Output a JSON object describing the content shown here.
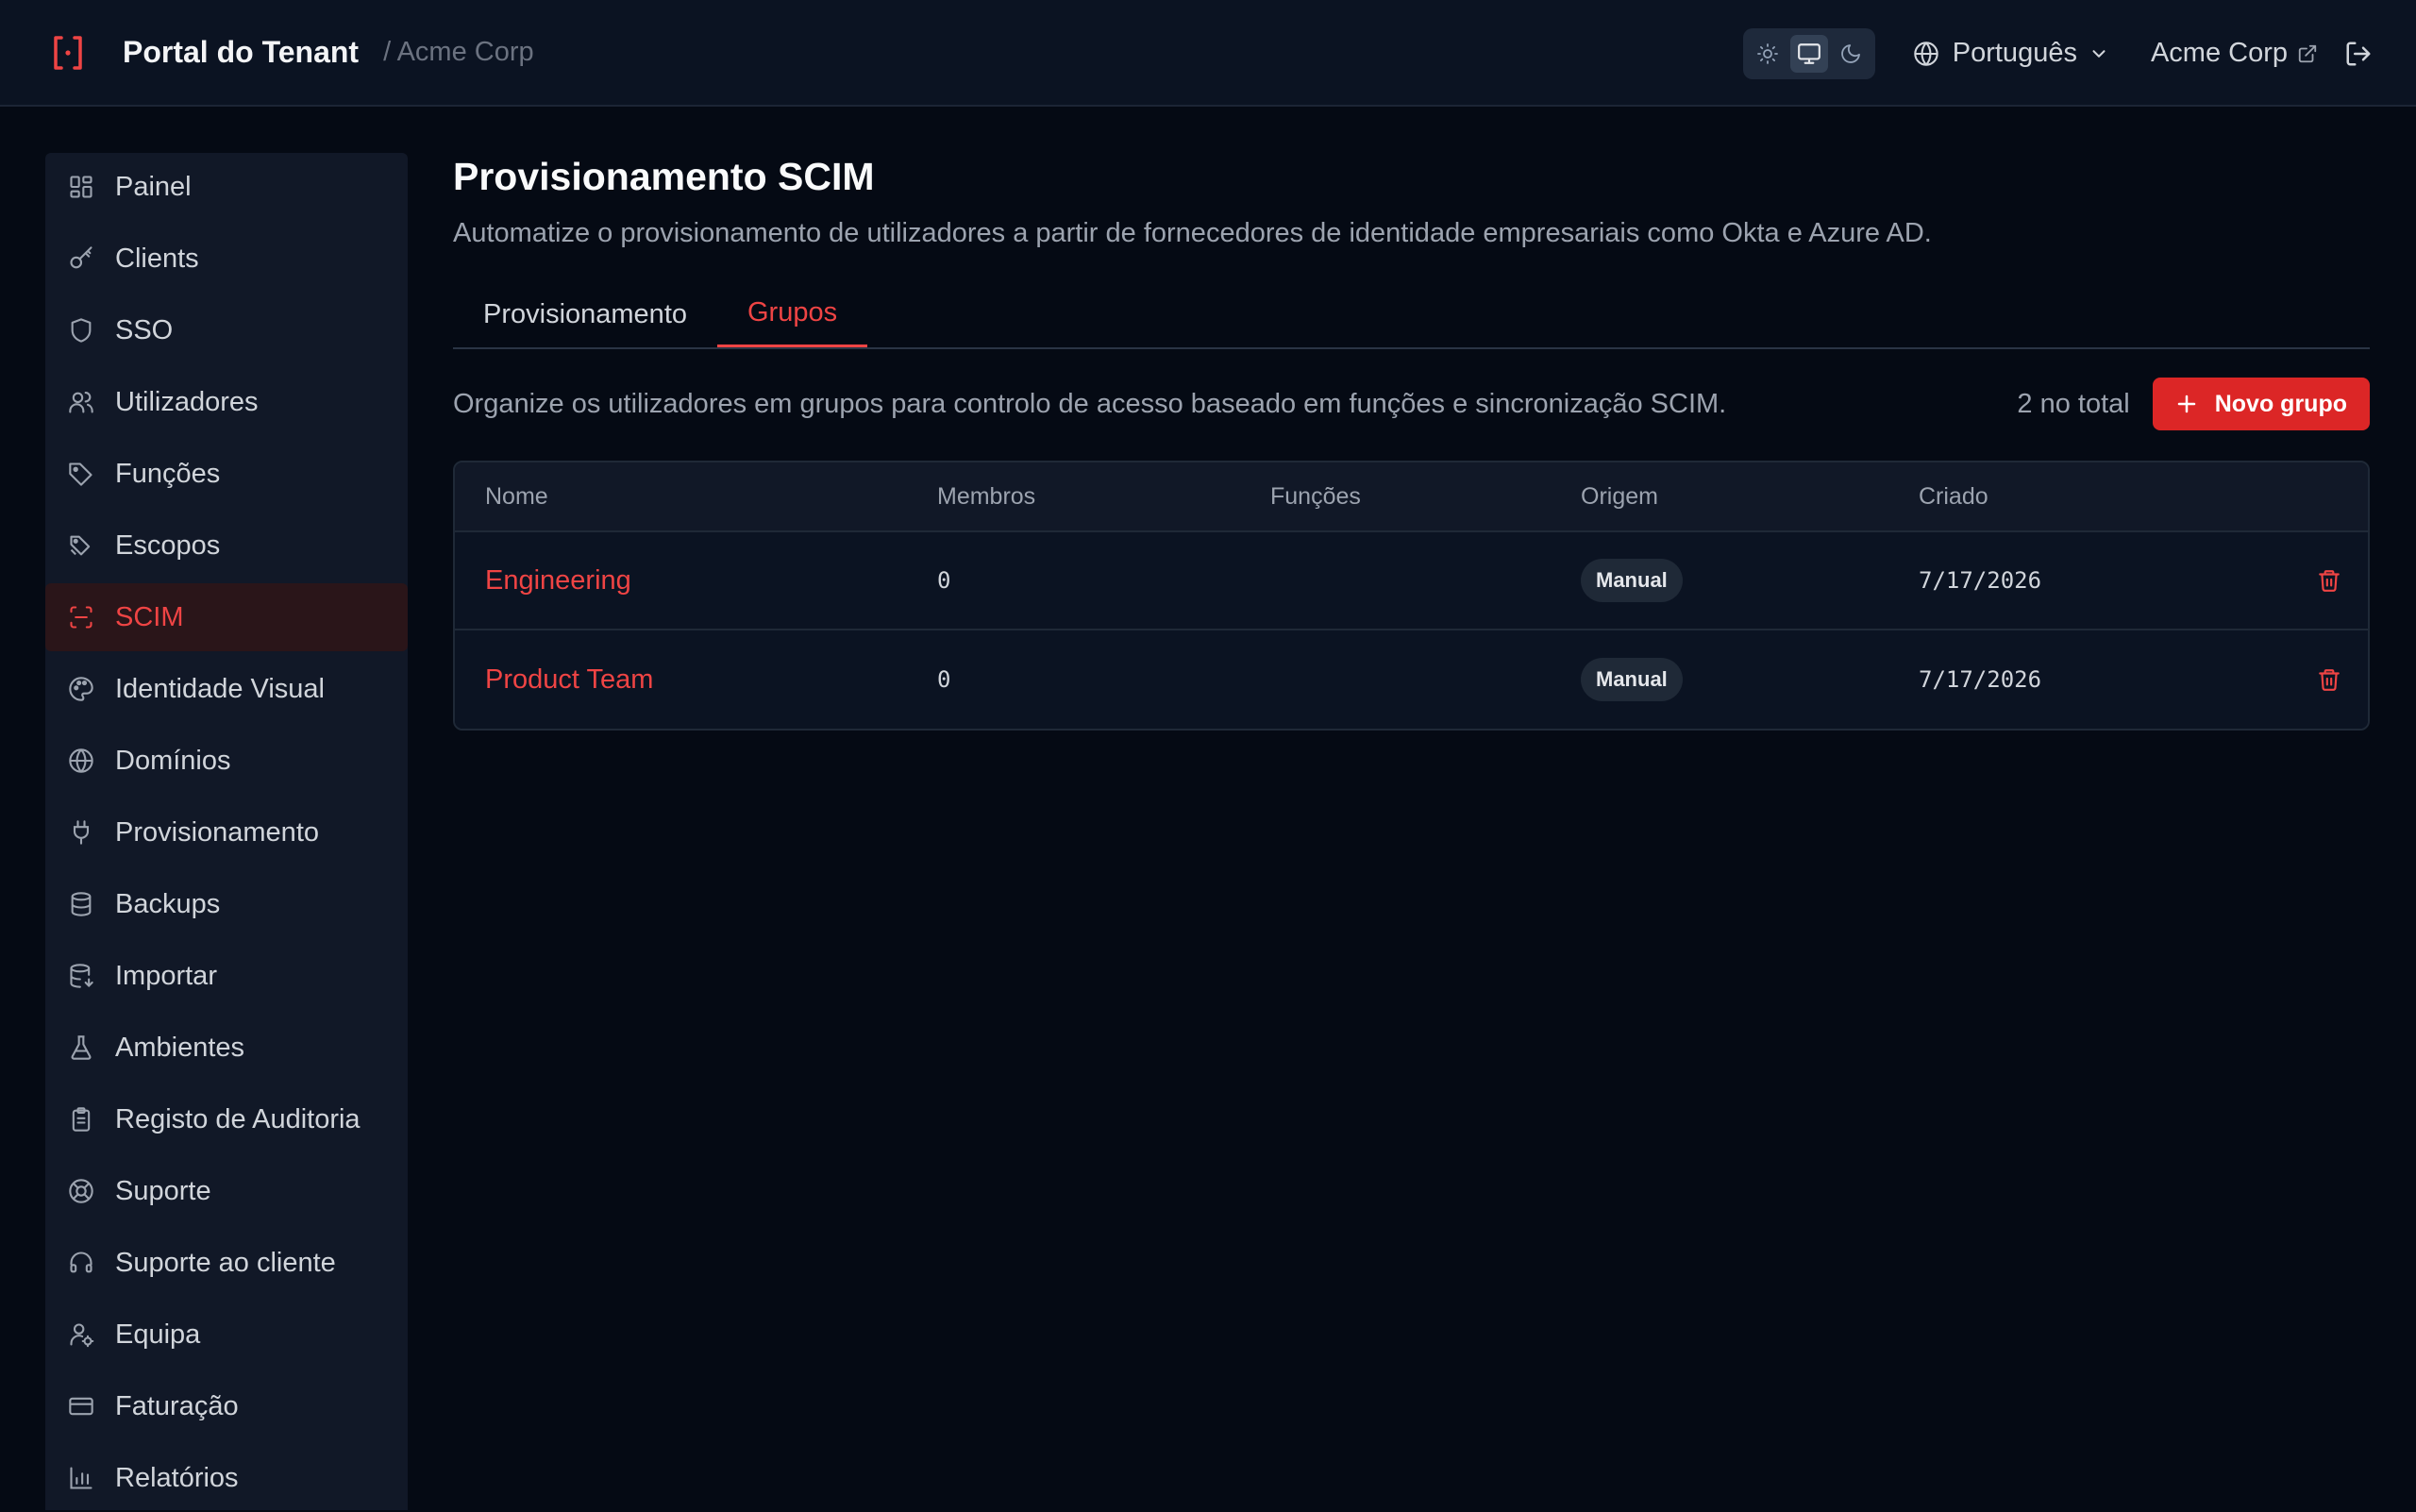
{
  "header": {
    "title": "Portal do Tenant",
    "breadcrumb": "/ Acme Corp",
    "theme_options": [
      "sun-icon",
      "monitor-icon",
      "moon-icon"
    ],
    "theme_selected": "monitor-icon",
    "language": "Português",
    "tenant_name": "Acme Corp"
  },
  "sidebar": {
    "items": [
      {
        "label": "Painel",
        "icon": "dashboard-icon"
      },
      {
        "label": "Clients",
        "icon": "key-icon"
      },
      {
        "label": "SSO",
        "icon": "shield-icon"
      },
      {
        "label": "Utilizadores",
        "icon": "users-icon"
      },
      {
        "label": "Funções",
        "icon": "tag-icon"
      },
      {
        "label": "Escopos",
        "icon": "tags-icon"
      },
      {
        "label": "SCIM",
        "icon": "scan-icon",
        "active": true
      },
      {
        "label": "Identidade Visual",
        "icon": "palette-icon"
      },
      {
        "label": "Domínios",
        "icon": "globe-icon"
      },
      {
        "label": "Provisionamento",
        "icon": "plug-icon"
      },
      {
        "label": "Backups",
        "icon": "database-icon"
      },
      {
        "label": "Importar",
        "icon": "database-import-icon"
      },
      {
        "label": "Ambientes",
        "icon": "flask-icon"
      },
      {
        "label": "Registo de Auditoria",
        "icon": "clipboard-icon"
      },
      {
        "label": "Suporte",
        "icon": "lifebuoy-icon"
      },
      {
        "label": "Suporte ao cliente",
        "icon": "headset-icon"
      },
      {
        "label": "Equipa",
        "icon": "user-cog-icon"
      },
      {
        "label": "Faturação",
        "icon": "credit-card-icon"
      },
      {
        "label": "Relatórios",
        "icon": "bar-chart-icon"
      }
    ]
  },
  "main": {
    "title": "Provisionamento SCIM",
    "description": "Automatize o provisionamento de utilizadores a partir de fornecedores de identidade empresariais como Okta e Azure AD.",
    "tabs": [
      {
        "label": "Provisionamento",
        "active": false
      },
      {
        "label": "Grupos",
        "active": true
      }
    ],
    "toolbar_text": "Organize os utilizadores em grupos para controlo de acesso baseado em funções e sincronização SCIM.",
    "count": "2 no total",
    "new_button": "Novo grupo",
    "table": {
      "columns": [
        "Nome",
        "Membros",
        "Funções",
        "Origem",
        "Criado"
      ],
      "rows": [
        {
          "name": "Engineering",
          "members": "0",
          "roles": "",
          "origin": "Manual",
          "created": "7/17/2026"
        },
        {
          "name": "Product Team",
          "members": "0",
          "roles": "",
          "origin": "Manual",
          "created": "7/17/2026"
        }
      ]
    }
  },
  "colors": {
    "accent": "#ef4444",
    "button_bg": "#dc2626",
    "background": "#050a14",
    "header_bg": "#0b1322",
    "sidebar_bg": "#111827"
  }
}
